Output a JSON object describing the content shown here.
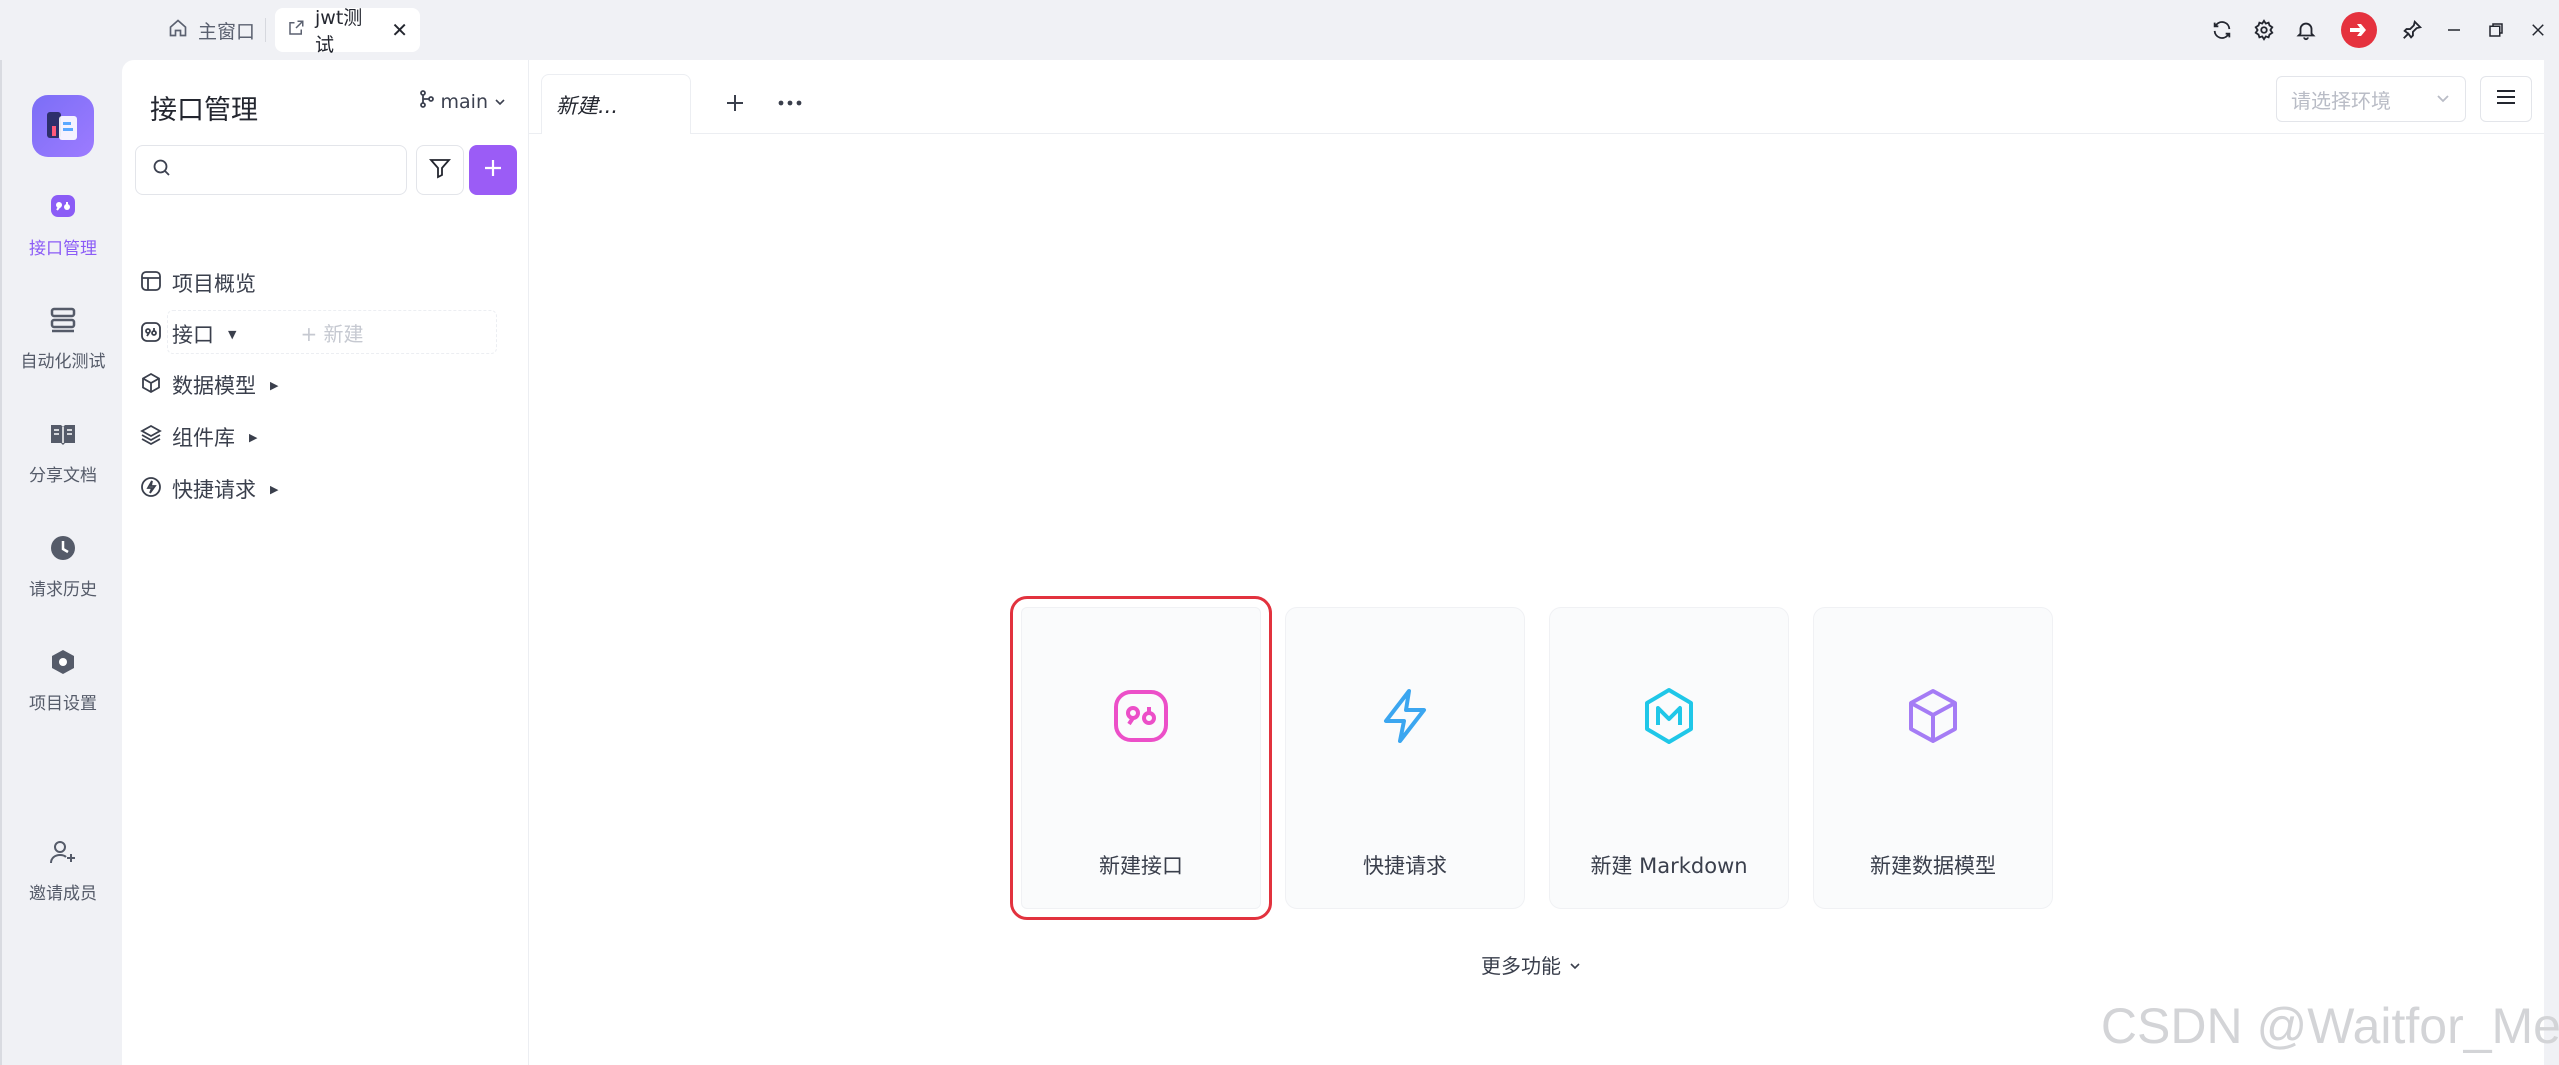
{
  "titlebar": {
    "home_tab": "主窗口",
    "active_tab": "jwt测试",
    "close_glyph": "✕"
  },
  "rail": {
    "items": [
      {
        "label": "接口管理",
        "icon": "api-icon",
        "active": true
      },
      {
        "label": "自动化测试",
        "icon": "automation-icon",
        "active": false
      },
      {
        "label": "分享文档",
        "icon": "book-icon",
        "active": false
      },
      {
        "label": "请求历史",
        "icon": "clock-icon",
        "active": false
      },
      {
        "label": "项目设置",
        "icon": "settings-icon",
        "active": false
      },
      {
        "label": "邀请成员",
        "icon": "add-user-icon",
        "active": false
      }
    ]
  },
  "sidebar": {
    "title": "接口管理",
    "branch": "main",
    "search_placeholder": "",
    "tree": [
      {
        "label": "项目概览",
        "icon": "layout-icon",
        "caret": false
      },
      {
        "label": "接口",
        "icon": "api-icon",
        "caret": true
      },
      {
        "label": "数据模型",
        "icon": "cube-icon",
        "caret": true
      },
      {
        "label": "组件库",
        "icon": "layers-icon",
        "caret": true
      },
      {
        "label": "快捷请求",
        "icon": "bolt-icon",
        "caret": true
      }
    ],
    "new_row": "+ 新建"
  },
  "main": {
    "doc_tab": "新建...",
    "env_placeholder": "请选择环境",
    "cards": [
      {
        "label": "新建接口",
        "icon": "api-icon",
        "color": "#ec4fc8"
      },
      {
        "label": "快捷请求",
        "icon": "bolt-icon",
        "color": "#3ba6f0"
      },
      {
        "label": "新建 Markdown",
        "icon": "markdown-icon",
        "color": "#1fc7e8"
      },
      {
        "label": "新建数据模型",
        "icon": "cube-icon",
        "color": "#a57cf5"
      }
    ],
    "more": "更多功能"
  },
  "colors": {
    "accent": "#9b5cf6",
    "highlight": "#e2323e"
  },
  "watermark": "CSDN @Waitfor_Me"
}
